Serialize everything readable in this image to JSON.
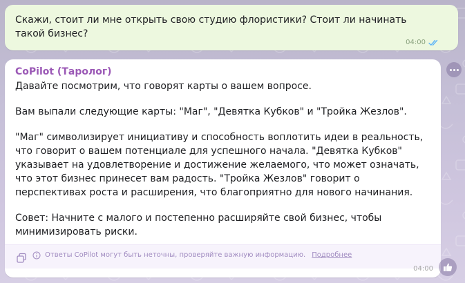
{
  "messages": {
    "outgoing": {
      "text": "Скажи, стоит ли мне открыть свою студию флористики? Стоит ли начинать такой бизнес?",
      "time": "04:00",
      "status_icon": "double-check-icon"
    },
    "incoming": {
      "sender": "CoPilot (Таролог)",
      "paragraphs": [
        "Давайте посмотрим, что говорят карты о вашем вопросе.",
        "Вам выпали следующие карты: \"Маг\", \"Девятка Кубков\" и \"Тройка Жезлов\".",
        "\"Маг\" символизирует инициативу и способность воплотить идеи в реальность, что говорит о вашем потенциале для успешного начала. \"Девятка Кубков\" указывает на удовлетворение и достижение желаемого, что может означать, что этот бизнес принесет вам радость. \"Тройка Жезлов\" говорит о перспективах роста и расширения, что благоприятно для нового начинания.",
        "Совет: Начните с малого и постепенно расширяйте свой бизнес, чтобы минимизировать риски."
      ],
      "disclaimer": "Ответы CoPilot могут быть неточны, проверяйте важную информацию.",
      "more_link": "Подробнее",
      "time": "04:00"
    }
  },
  "icons": {
    "copy": "copy-icon",
    "info": "info-icon",
    "more": "more-horizontal-icon",
    "like": "thumbs-up-icon"
  },
  "colors": {
    "outgoing_bubble": "#edf8df",
    "incoming_bubble": "#ffffff",
    "sender_name": "#9b59b6",
    "disclaimer": "#a08bc0",
    "read_ticks": "#5eb5f7"
  }
}
